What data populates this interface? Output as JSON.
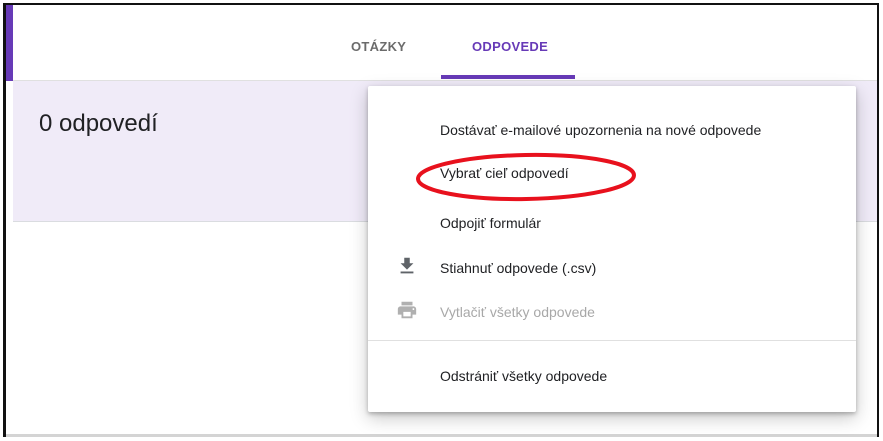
{
  "tabs": {
    "questions": "OTÁZKY",
    "responses": "ODPOVEDE",
    "active": "responses"
  },
  "summary": {
    "count_label": "0 odpovedí"
  },
  "menu": {
    "items": [
      {
        "label": "Dostávať e-mailové upozornenia na nové odpovede",
        "icon": null,
        "enabled": true
      },
      {
        "label": "Vybrať cieľ odpovedí",
        "icon": null,
        "enabled": true,
        "highlighted": true
      },
      {
        "label": "Odpojiť formulár",
        "icon": null,
        "enabled": true
      },
      {
        "label": "Stiahnuť odpovede (.csv)",
        "icon": "download-icon",
        "enabled": true
      },
      {
        "label": "Vytlačiť všetky odpovede",
        "icon": "print-icon",
        "enabled": false
      },
      {
        "label": "Odstrániť všetky odpovede",
        "icon": null,
        "enabled": true
      }
    ]
  },
  "colors": {
    "accent": "#673ab7",
    "summary_background": "#f0ebf8",
    "annotation": "#e8111d",
    "disabled_text": "#a8a8a8"
  }
}
